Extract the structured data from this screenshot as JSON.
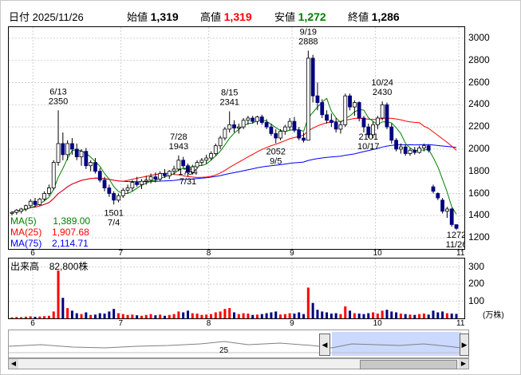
{
  "header": {
    "date_label": "日付",
    "date": "2025/11/26",
    "open_label": "始値",
    "open": "1,319",
    "high_label": "高値",
    "high": "1,319",
    "low_label": "安値",
    "low": "1,272",
    "close_label": "終値",
    "close": "1,286",
    "colors": {
      "high": "#ff0000",
      "low": "#008000"
    }
  },
  "price_axis": [
    "3000",
    "2800",
    "2600",
    "2400",
    "2200",
    "2000",
    "1800",
    "1600",
    "1400",
    "1200"
  ],
  "months": [
    "6",
    "7",
    "8",
    "9",
    "10",
    "11"
  ],
  "annotations": [
    {
      "date": "6/13",
      "value": "2350"
    },
    {
      "date": "7/4",
      "value": "1501"
    },
    {
      "date": "7/28",
      "value": "1943"
    },
    {
      "date": "7/31",
      "value": "1754"
    },
    {
      "date": "8/15",
      "value": "2341"
    },
    {
      "date": "9/5",
      "value": "2052"
    },
    {
      "date": "9/19",
      "value": "2888"
    },
    {
      "date": "10/17",
      "value": "2101"
    },
    {
      "date": "10/24",
      "value": "2430"
    },
    {
      "date": "11/26",
      "value": "1272"
    }
  ],
  "ma_legend": [
    {
      "label": "MA(5)",
      "value": "1,389.00",
      "color": "#008000"
    },
    {
      "label": "MA(25)",
      "value": "1,907.68",
      "color": "#ff0000"
    },
    {
      "label": "MA(75)",
      "value": "2,114.71",
      "color": "#0000ff"
    }
  ],
  "volume": {
    "title": "出来高",
    "value": "82,800株",
    "axis": [
      "300",
      "200",
      "100"
    ],
    "unit": "(万株)"
  },
  "navigator": {
    "label": "25"
  },
  "chart_data": {
    "type": "candlestick",
    "price_range": [
      1100,
      3100
    ],
    "candles": [
      {
        "d": 0,
        "o": 1420,
        "h": 1440,
        "l": 1400,
        "c": 1430
      },
      {
        "d": 1,
        "o": 1430,
        "h": 1460,
        "l": 1410,
        "c": 1450
      },
      {
        "d": 2,
        "o": 1440,
        "h": 1470,
        "l": 1420,
        "c": 1460
      },
      {
        "d": 3,
        "o": 1460,
        "h": 1500,
        "l": 1440,
        "c": 1490
      },
      {
        "d": 4,
        "o": 1490,
        "h": 1550,
        "l": 1470,
        "c": 1530
      },
      {
        "d": 5,
        "o": 1530,
        "h": 1560,
        "l": 1480,
        "c": 1500
      },
      {
        "d": 6,
        "o": 1500,
        "h": 1560,
        "l": 1490,
        "c": 1550
      },
      {
        "d": 7,
        "o": 1550,
        "h": 1620,
        "l": 1530,
        "c": 1600
      },
      {
        "d": 8,
        "o": 1600,
        "h": 1680,
        "l": 1580,
        "c": 1650
      },
      {
        "d": 9,
        "o": 1650,
        "h": 1900,
        "l": 1630,
        "c": 1880
      },
      {
        "d": 10,
        "o": 1880,
        "h": 2350,
        "l": 1850,
        "c": 2050
      },
      {
        "d": 11,
        "o": 2050,
        "h": 2150,
        "l": 1900,
        "c": 1950
      },
      {
        "d": 12,
        "o": 1950,
        "h": 2080,
        "l": 1900,
        "c": 2050
      },
      {
        "d": 13,
        "o": 2050,
        "h": 2100,
        "l": 1950,
        "c": 2000
      },
      {
        "d": 14,
        "o": 2000,
        "h": 2050,
        "l": 1900,
        "c": 1930
      },
      {
        "d": 15,
        "o": 1930,
        "h": 2000,
        "l": 1850,
        "c": 1980
      },
      {
        "d": 16,
        "o": 1980,
        "h": 2010,
        "l": 1820,
        "c": 1850
      },
      {
        "d": 17,
        "o": 1850,
        "h": 1900,
        "l": 1800,
        "c": 1880
      },
      {
        "d": 18,
        "o": 1880,
        "h": 1920,
        "l": 1780,
        "c": 1800
      },
      {
        "d": 19,
        "o": 1800,
        "h": 1830,
        "l": 1700,
        "c": 1720
      },
      {
        "d": 20,
        "o": 1720,
        "h": 1750,
        "l": 1620,
        "c": 1650
      },
      {
        "d": 21,
        "o": 1650,
        "h": 1680,
        "l": 1570,
        "c": 1600
      },
      {
        "d": 22,
        "o": 1600,
        "h": 1620,
        "l": 1501,
        "c": 1540
      },
      {
        "d": 23,
        "o": 1540,
        "h": 1600,
        "l": 1520,
        "c": 1580
      },
      {
        "d": 24,
        "o": 1580,
        "h": 1650,
        "l": 1560,
        "c": 1630
      },
      {
        "d": 25,
        "o": 1630,
        "h": 1680,
        "l": 1600,
        "c": 1650
      },
      {
        "d": 26,
        "o": 1650,
        "h": 1720,
        "l": 1620,
        "c": 1700
      },
      {
        "d": 27,
        "o": 1700,
        "h": 1750,
        "l": 1660,
        "c": 1680
      },
      {
        "d": 28,
        "o": 1680,
        "h": 1730,
        "l": 1640,
        "c": 1710
      },
      {
        "d": 29,
        "o": 1710,
        "h": 1760,
        "l": 1680,
        "c": 1720
      },
      {
        "d": 30,
        "o": 1720,
        "h": 1780,
        "l": 1690,
        "c": 1750
      },
      {
        "d": 31,
        "o": 1750,
        "h": 1790,
        "l": 1700,
        "c": 1730
      },
      {
        "d": 32,
        "o": 1730,
        "h": 1800,
        "l": 1710,
        "c": 1780
      },
      {
        "d": 33,
        "o": 1780,
        "h": 1820,
        "l": 1740,
        "c": 1760
      },
      {
        "d": 34,
        "o": 1760,
        "h": 1810,
        "l": 1730,
        "c": 1800
      },
      {
        "d": 35,
        "o": 1800,
        "h": 1850,
        "l": 1770,
        "c": 1820
      },
      {
        "d": 36,
        "o": 1820,
        "h": 1943,
        "l": 1800,
        "c": 1900
      },
      {
        "d": 37,
        "o": 1900,
        "h": 1930,
        "l": 1830,
        "c": 1850
      },
      {
        "d": 38,
        "o": 1850,
        "h": 1870,
        "l": 1754,
        "c": 1790
      },
      {
        "d": 39,
        "o": 1790,
        "h": 1860,
        "l": 1770,
        "c": 1840
      },
      {
        "d": 40,
        "o": 1840,
        "h": 1900,
        "l": 1820,
        "c": 1880
      },
      {
        "d": 41,
        "o": 1880,
        "h": 1920,
        "l": 1850,
        "c": 1900
      },
      {
        "d": 42,
        "o": 1900,
        "h": 1950,
        "l": 1870,
        "c": 1920
      },
      {
        "d": 43,
        "o": 1920,
        "h": 1980,
        "l": 1900,
        "c": 1960
      },
      {
        "d": 44,
        "o": 1960,
        "h": 2050,
        "l": 1940,
        "c": 2030
      },
      {
        "d": 45,
        "o": 2030,
        "h": 2120,
        "l": 2000,
        "c": 2100
      },
      {
        "d": 46,
        "o": 2100,
        "h": 2200,
        "l": 2080,
        "c": 2180
      },
      {
        "d": 47,
        "o": 2180,
        "h": 2341,
        "l": 2150,
        "c": 2220
      },
      {
        "d": 48,
        "o": 2220,
        "h": 2260,
        "l": 2150,
        "c": 2190
      },
      {
        "d": 49,
        "o": 2190,
        "h": 2230,
        "l": 2140,
        "c": 2200
      },
      {
        "d": 50,
        "o": 2200,
        "h": 2280,
        "l": 2180,
        "c": 2260
      },
      {
        "d": 51,
        "o": 2260,
        "h": 2300,
        "l": 2220,
        "c": 2280
      },
      {
        "d": 52,
        "o": 2280,
        "h": 2300,
        "l": 2230,
        "c": 2250
      },
      {
        "d": 53,
        "o": 2250,
        "h": 2300,
        "l": 2220,
        "c": 2290
      },
      {
        "d": 54,
        "o": 2290,
        "h": 2310,
        "l": 2220,
        "c": 2240
      },
      {
        "d": 55,
        "o": 2240,
        "h": 2270,
        "l": 2180,
        "c": 2200
      },
      {
        "d": 56,
        "o": 2200,
        "h": 2230,
        "l": 2120,
        "c": 2140
      },
      {
        "d": 57,
        "o": 2140,
        "h": 2180,
        "l": 2052,
        "c": 2100
      },
      {
        "d": 58,
        "o": 2100,
        "h": 2180,
        "l": 2080,
        "c": 2160
      },
      {
        "d": 59,
        "o": 2160,
        "h": 2220,
        "l": 2130,
        "c": 2200
      },
      {
        "d": 60,
        "o": 2200,
        "h": 2280,
        "l": 2170,
        "c": 2250
      },
      {
        "d": 61,
        "o": 2250,
        "h": 2290,
        "l": 2150,
        "c": 2170
      },
      {
        "d": 62,
        "o": 2170,
        "h": 2200,
        "l": 2080,
        "c": 2100
      },
      {
        "d": 63,
        "o": 2100,
        "h": 2150,
        "l": 2060,
        "c": 2080
      },
      {
        "d": 64,
        "o": 2080,
        "h": 2888,
        "l": 2350,
        "c": 2820
      },
      {
        "d": 65,
        "o": 2820,
        "h": 2850,
        "l": 2420,
        "c": 2480
      },
      {
        "d": 66,
        "o": 2480,
        "h": 2600,
        "l": 2350,
        "c": 2420
      },
      {
        "d": 67,
        "o": 2420,
        "h": 2450,
        "l": 2280,
        "c": 2310
      },
      {
        "d": 68,
        "o": 2310,
        "h": 2350,
        "l": 2230,
        "c": 2260
      },
      {
        "d": 69,
        "o": 2260,
        "h": 2320,
        "l": 2200,
        "c": 2240
      },
      {
        "d": 70,
        "o": 2240,
        "h": 2280,
        "l": 2150,
        "c": 2180
      },
      {
        "d": 71,
        "o": 2180,
        "h": 2250,
        "l": 2140,
        "c": 2220
      },
      {
        "d": 72,
        "o": 2220,
        "h": 2500,
        "l": 2200,
        "c": 2480
      },
      {
        "d": 73,
        "o": 2480,
        "h": 2500,
        "l": 2350,
        "c": 2380
      },
      {
        "d": 74,
        "o": 2380,
        "h": 2440,
        "l": 2300,
        "c": 2420
      },
      {
        "d": 75,
        "o": 2420,
        "h": 2430,
        "l": 2250,
        "c": 2280
      },
      {
        "d": 76,
        "o": 2280,
        "h": 2300,
        "l": 2150,
        "c": 2200
      },
      {
        "d": 77,
        "o": 2200,
        "h": 2230,
        "l": 2101,
        "c": 2130
      },
      {
        "d": 78,
        "o": 2130,
        "h": 2250,
        "l": 2100,
        "c": 2220
      },
      {
        "d": 79,
        "o": 2220,
        "h": 2300,
        "l": 2180,
        "c": 2280
      },
      {
        "d": 80,
        "o": 2280,
        "h": 2430,
        "l": 2260,
        "c": 2400
      },
      {
        "d": 81,
        "o": 2400,
        "h": 2420,
        "l": 2180,
        "c": 2200
      },
      {
        "d": 82,
        "o": 2200,
        "h": 2230,
        "l": 2050,
        "c": 2080
      },
      {
        "d": 83,
        "o": 2080,
        "h": 2100,
        "l": 1980,
        "c": 2000
      },
      {
        "d": 84,
        "o": 2000,
        "h": 2050,
        "l": 1960,
        "c": 2020
      },
      {
        "d": 85,
        "o": 2020,
        "h": 2040,
        "l": 1940,
        "c": 1960
      },
      {
        "d": 86,
        "o": 1960,
        "h": 2010,
        "l": 1940,
        "c": 1990
      },
      {
        "d": 87,
        "o": 1990,
        "h": 2020,
        "l": 1950,
        "c": 1970
      },
      {
        "d": 88,
        "o": 1970,
        "h": 2030,
        "l": 1960,
        "c": 2010
      },
      {
        "d": 89,
        "o": 2010,
        "h": 2050,
        "l": 1980,
        "c": 2030
      },
      {
        "d": 90,
        "o": 2030,
        "h": 2040,
        "l": 1970,
        "c": 1990
      },
      {
        "d": 91,
        "o": 1660,
        "h": 1680,
        "l": 1600,
        "c": 1620
      },
      {
        "d": 92,
        "o": 1600,
        "h": 1610,
        "l": 1540,
        "c": 1560
      },
      {
        "d": 93,
        "o": 1540,
        "h": 1560,
        "l": 1420,
        "c": 1440
      },
      {
        "d": 94,
        "o": 1440,
        "h": 1480,
        "l": 1380,
        "c": 1460
      },
      {
        "d": 95,
        "o": 1460,
        "h": 1470,
        "l": 1300,
        "c": 1320
      },
      {
        "d": 96,
        "o": 1319,
        "h": 1319,
        "l": 1272,
        "c": 1286
      }
    ],
    "month_starts": [
      4,
      23,
      42,
      60,
      78,
      96
    ],
    "volumes": [
      6,
      8,
      7,
      10,
      12,
      9,
      11,
      13,
      15,
      40,
      280,
      120,
      60,
      45,
      30,
      25,
      35,
      20,
      22,
      30,
      28,
      40,
      55,
      30,
      25,
      20,
      22,
      18,
      15,
      20,
      25,
      18,
      22,
      15,
      20,
      25,
      40,
      35,
      45,
      30,
      28,
      20,
      22,
      25,
      35,
      40,
      55,
      60,
      35,
      25,
      30,
      28,
      20,
      22,
      25,
      30,
      35,
      40,
      22,
      25,
      30,
      28,
      35,
      25,
      180,
      90,
      50,
      40,
      35,
      28,
      30,
      25,
      70,
      45,
      30,
      28,
      25,
      30,
      35,
      28,
      45,
      50,
      40,
      35,
      28,
      25,
      22,
      20,
      25,
      28,
      22,
      45,
      35,
      40,
      30,
      28,
      26
    ]
  }
}
